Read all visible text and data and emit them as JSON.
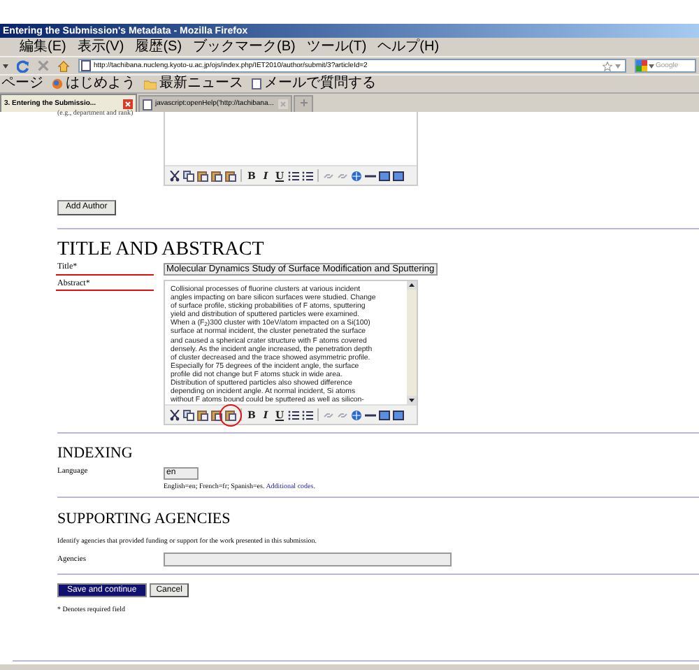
{
  "window": {
    "title": "Entering the Submission's Metadata - Mozilla Firefox"
  },
  "menu": [
    "編集(E)",
    "表示(V)",
    "履歴(S)",
    "ブックマーク(B)",
    "ツール(T)",
    "ヘルプ(H)"
  ],
  "address_bar": {
    "url": "http://tachibana.nucleng.kyoto-u.ac.jp/ojs/index.php/IET2010/author/submit/3?articleId=2"
  },
  "search": {
    "placeholder": "Google"
  },
  "bookmarks": [
    "ページ",
    "はじめよう",
    "最新ニュース",
    "メールで質問する"
  ],
  "tabs": [
    {
      "label": "3. Entering the Submissio...",
      "selected": true
    },
    {
      "label": "javascript:openHelp('http://tachibana...",
      "selected": false
    }
  ],
  "author_editor": {
    "hint": "(e.g., department and rank)",
    "toolbar": [
      {
        "kind": "cut"
      },
      {
        "kind": "copy"
      },
      {
        "kind": "paste"
      },
      {
        "kind": "paste"
      },
      {
        "kind": "paste"
      },
      {
        "kind": "separator"
      },
      {
        "kind": "text",
        "label": "B"
      },
      {
        "kind": "text",
        "label": "I"
      },
      {
        "kind": "text",
        "label": "U"
      },
      {
        "kind": "bullets"
      },
      {
        "kind": "bullets"
      },
      {
        "kind": "separator"
      },
      {
        "kind": "link"
      },
      {
        "kind": "link"
      },
      {
        "kind": "globe"
      },
      {
        "kind": "rule"
      },
      {
        "kind": "box"
      },
      {
        "kind": "box"
      }
    ]
  },
  "add_author": "Add Author",
  "title_abstract": {
    "heading": "TITLE AND ABSTRACT",
    "title": {
      "label": "Title*",
      "value": "Molecular Dynamics Study of Surface Modification and Sputtering",
      "marked": true
    },
    "abstract": {
      "label": "Abstract*",
      "marked": true,
      "value": "Collisional processes of fluorine clusters at various incident\nangles impacting on bare silicon surfaces were studied. Change\nof surface profile, sticking probabilities of F atoms, sputtering\nyield and distribution of sputtered particles were examined.\nWhen a (F$_{2}$)300 cluster with 10eV/atom impacted on a Si(100)\nsurface at normal incident, the cluster penetrated the surface\nand caused a spherical crater structure with F atoms covered\ndensely. As the incident angle increased, the penetration depth\nof cluster decreased and the trace showed asymmetric profile.\nEspecially for 75 degrees of the incident angle, the surface\nprofile did not change but F atoms stuck in wide area.\nDistribution of sputtered particles also showed difference\ndepending on incident angle. At normal incident, Si atoms\nwithout F atoms bound could be sputtered as well as silicon-"
    },
    "toolbar": [
      {
        "kind": "cut",
        "circled": false
      },
      {
        "kind": "copy",
        "circled": false
      },
      {
        "kind": "paste",
        "circled": false
      },
      {
        "kind": "paste",
        "circled": false
      },
      {
        "kind": "paste",
        "circled": true
      },
      {
        "kind": "separator",
        "circled": false
      },
      {
        "kind": "text",
        "label": "B",
        "circled": false
      },
      {
        "kind": "text",
        "label": "I",
        "circled": false
      },
      {
        "kind": "text",
        "label": "U",
        "circled": false
      },
      {
        "kind": "bullets",
        "circled": false
      },
      {
        "kind": "bullets",
        "circled": false
      },
      {
        "kind": "separator",
        "circled": false
      },
      {
        "kind": "link",
        "circled": false
      },
      {
        "kind": "link",
        "circled": false
      },
      {
        "kind": "globe",
        "circled": false
      },
      {
        "kind": "rule",
        "circled": false
      },
      {
        "kind": "box",
        "circled": false
      },
      {
        "kind": "box",
        "circled": false
      }
    ]
  },
  "indexing": {
    "heading": "INDEXING",
    "label": "Language",
    "value": "en",
    "help": "English=en; French=fr; Spanish=es.",
    "help_link": "Additional codes."
  },
  "agencies": {
    "heading": "SUPPORTING AGENCIES",
    "description": "Identify agencies that provided funding or support for the work presented in this submission.",
    "label": "Agencies"
  },
  "buttons": [
    {
      "label": "Save and continue",
      "kind": "primary"
    },
    {
      "label": "Cancel",
      "kind": "secondary"
    }
  ],
  "footnote": "* Denotes required field"
}
